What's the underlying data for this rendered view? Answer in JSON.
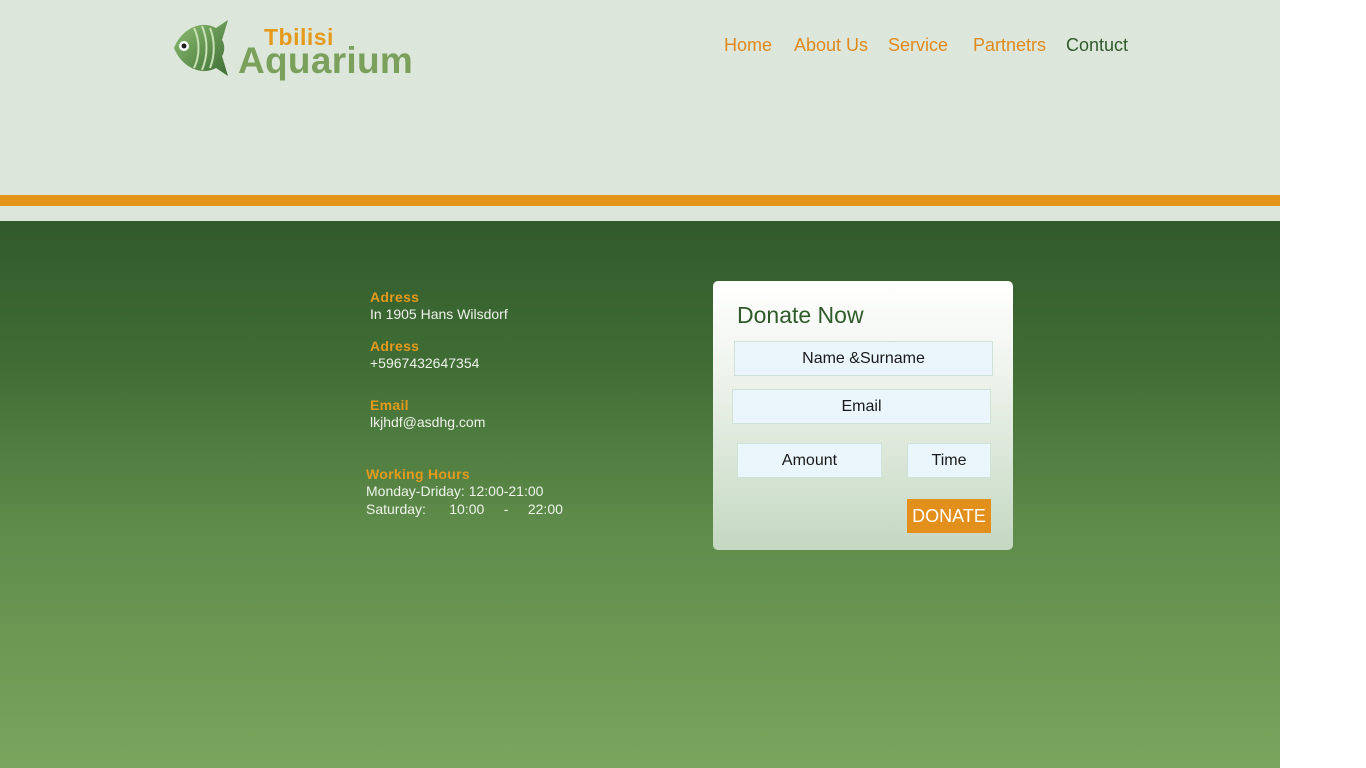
{
  "header": {
    "logo": {
      "small_text": "Tbilisi",
      "big_text": "Aquarium"
    },
    "nav": [
      {
        "label": "Home",
        "active": false
      },
      {
        "label": "About Us",
        "active": false
      },
      {
        "label": "Service",
        "active": false
      },
      {
        "label": "Partnetrs",
        "active": false
      },
      {
        "label": "Contuct",
        "active": true
      }
    ]
  },
  "contact": {
    "address": {
      "label": "Adress",
      "value": "In 1905 Hans Wilsdorf"
    },
    "phone": {
      "label": "Adress",
      "value": "+5967432647354"
    },
    "email": {
      "label": "Email",
      "value": "lkjhdf@asdhg.com"
    },
    "hours": {
      "label": "Working Hours",
      "weekdays": "Monday-Driday: 12:00-21:00",
      "saturday": "Saturday:      10:00     -     22:00"
    }
  },
  "donate": {
    "title": "Donate Now",
    "name_placeholder": "Name &Surname",
    "email_placeholder": "Email",
    "amount_placeholder": "Amount",
    "time_placeholder": "Time",
    "button_label": "DONATE"
  },
  "colors": {
    "accent_orange": "#e39419",
    "header_bg": "#dce6da",
    "dark_green": "#325a2c",
    "light_green": "#7aa55d"
  },
  "icons": {
    "logo": "fish-icon"
  }
}
